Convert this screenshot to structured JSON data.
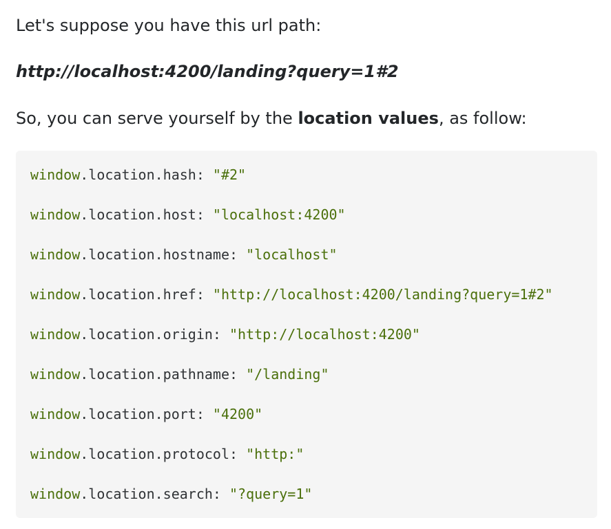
{
  "intro": {
    "line1": "Let's suppose you have this url path:",
    "url": "http://localhost:4200/landing?query=1#2",
    "line3_before": "So, you can serve yourself by the ",
    "line3_bold": "location values",
    "line3_after": ", as follow:"
  },
  "code": {
    "lines": [
      {
        "obj": "window",
        "prop": ".location.hash: ",
        "value": "\"#2\""
      },
      {
        "obj": "window",
        "prop": ".location.host: ",
        "value": "\"localhost:4200\""
      },
      {
        "obj": "window",
        "prop": ".location.hostname: ",
        "value": "\"localhost\""
      },
      {
        "obj": "window",
        "prop": ".location.href: ",
        "value": "\"http://localhost:4200/landing?query=1#2\""
      },
      {
        "obj": "window",
        "prop": ".location.origin: ",
        "value": "\"http://localhost:4200\""
      },
      {
        "obj": "window",
        "prop": ".location.pathname: ",
        "value": "\"/landing\""
      },
      {
        "obj": "window",
        "prop": ".location.port: ",
        "value": "\"4200\""
      },
      {
        "obj": "window",
        "prop": ".location.protocol: ",
        "value": "\"http:\""
      },
      {
        "obj": "window",
        "prop": ".location.search: ",
        "value": "\"?query=1\""
      }
    ]
  }
}
